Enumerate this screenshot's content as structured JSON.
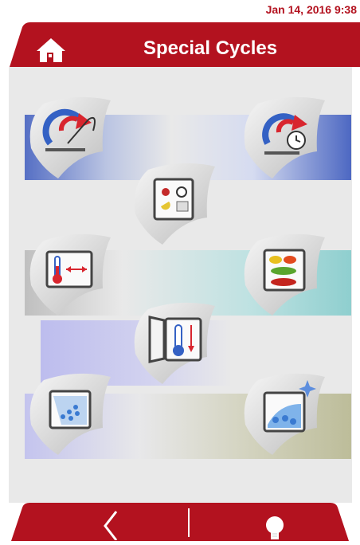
{
  "status_bar": {
    "datetime": "Jan 14, 2016  9:38"
  },
  "header": {
    "title": "Special Cycles"
  },
  "cycles": [
    {
      "icon": "delayed-start-cycle-icon"
    },
    {
      "icon": "timed-cycle-icon"
    },
    {
      "icon": "calendar-schedule-icon"
    },
    {
      "icon": "temperature-range-icon"
    },
    {
      "icon": "food-shelves-icon"
    },
    {
      "icon": "blast-chill-open-door-icon"
    },
    {
      "icon": "defrost-icon"
    },
    {
      "icon": "sanitize-cycle-icon"
    }
  ],
  "footer": {
    "back_icon": "chevron-left-icon",
    "light_icon": "light-bulb-icon"
  },
  "colors": {
    "brand_red": "#b3121f",
    "panel_gray": "#e9e9e9"
  }
}
